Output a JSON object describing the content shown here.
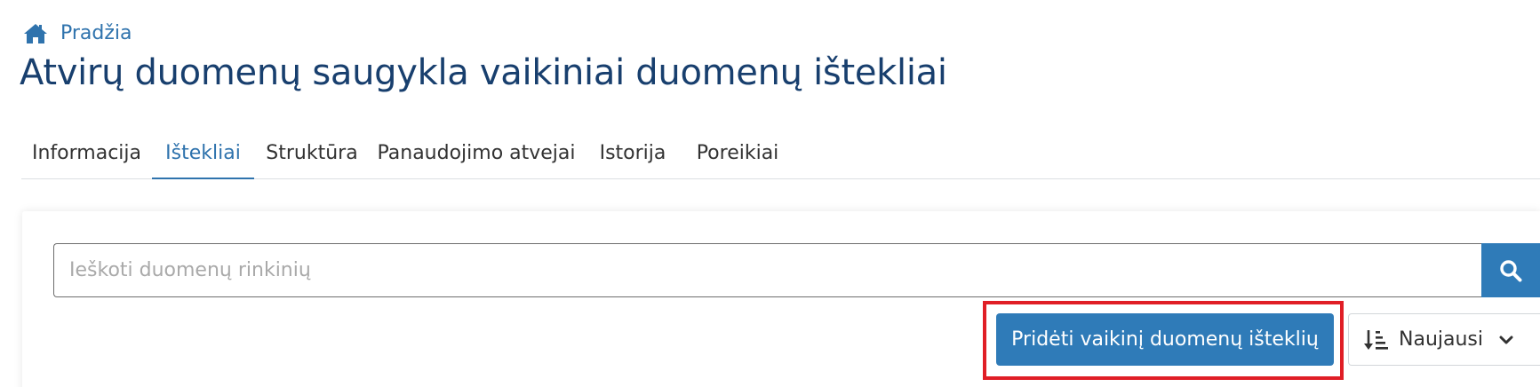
{
  "breadcrumb": {
    "home_label": "Pradžia"
  },
  "page": {
    "title": "Atvirų duomenų saugykla vaikiniai duomenų ištekliai"
  },
  "tabs": [
    {
      "label": "Informacija",
      "active": false
    },
    {
      "label": "Ištekliai",
      "active": true
    },
    {
      "label": "Struktūra",
      "active": false
    },
    {
      "label": "Panaudojimo atvejai",
      "active": false
    },
    {
      "label": "Istorija",
      "active": false
    },
    {
      "label": "Poreikiai",
      "active": false
    }
  ],
  "search": {
    "placeholder": "Ieškoti duomenų rinkinių",
    "value": ""
  },
  "actions": {
    "add_child_label": "Pridėti vaikinį duomenų išteklių"
  },
  "sort": {
    "selected": "Naujausi"
  },
  "colors": {
    "accent": "#2f7bb8",
    "title": "#183f6e",
    "highlight": "#e01e26"
  },
  "icons": {
    "breadcrumb": "home-icon",
    "search": "search-icon",
    "sort": "sort-descending-icon",
    "dropdown": "chevron-down-icon"
  }
}
